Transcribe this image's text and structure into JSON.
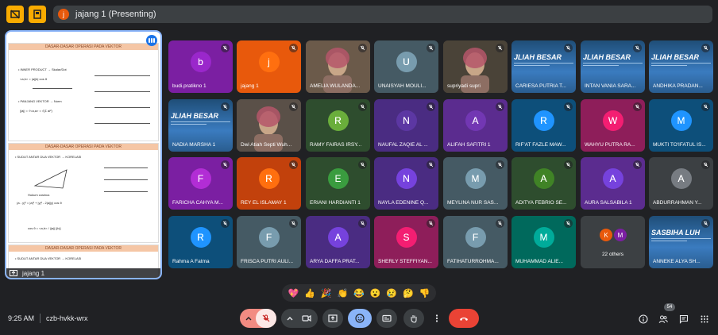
{
  "colors": {
    "accent": "#8ab4f8",
    "leave": "#ea4335",
    "active_btn": "#8ab4f8",
    "warning": "#f9ab00"
  },
  "topbar": {
    "presenter_initial": "j",
    "presenting_text": "jajang 1 (Presenting)"
  },
  "stage": {
    "presenter_label": "jajang 1",
    "slides": [
      {
        "heading": "DASAR-DASAR OPERASI PADA VEKTOR",
        "lines": [
          "• INNER PRODUCT → Skalar/Dot",
          "<a,b> = |a||b| cos θ",
          "• PANJANG VEKTOR → Norm",
          "||a|| = √<a,a> = √(Σ ai²)"
        ]
      },
      {
        "heading": "DASAR-DASAR OPERASI PADA VEKTOR",
        "lines": [
          "• SUDUT ANTAR DUA VEKTOR → KORELASI",
          "Hukum cosinus",
          "(a - y)² = |a|² + |y|² - 2|a||y| cos θ",
          "cos θ = <a,b> / ||a|| ||b||"
        ]
      },
      {
        "heading": "DASAR-DASAR OPERASI PADA VEKTOR",
        "lines": [
          "• SUDUT ANTAR DUA VEKTOR → KORELASI"
        ]
      }
    ]
  },
  "tiles": [
    {
      "name": "budi.pratikno 1",
      "initial": "b",
      "bg": "#7b1fa2",
      "av": "#7b1fa2",
      "type": "initial"
    },
    {
      "name": "jajang 1",
      "initial": "j",
      "bg": "#e8590c",
      "av": "#e8590c",
      "type": "initial"
    },
    {
      "name": "AMELIA WULANDA...",
      "type": "camera",
      "bg": "#6b5a4a"
    },
    {
      "name": "UNAISYAH MOULI...",
      "initial": "U",
      "bg": "#455a64",
      "av": "#607d8b",
      "type": "initial"
    },
    {
      "name": "supriyadi supri",
      "type": "camera",
      "bg": "#4a4338"
    },
    {
      "name": "CARIESA PUTRIA T...",
      "type": "banner",
      "banner": "JLIAH BESAR"
    },
    {
      "name": "INTAN VANIA SARA...",
      "type": "banner",
      "banner": "JLIAH BESAR"
    },
    {
      "name": "ANDHIKA PRADAN...",
      "type": "banner",
      "banner": "JLIAH BESAR"
    },
    {
      "name": "NADIA MARSHA 1",
      "type": "banner",
      "banner": "JLIAH BESAR"
    },
    {
      "name": "Dwi Atiah Septi Wuh...",
      "type": "camera",
      "bg": "#5a5048"
    },
    {
      "name": "RAMY FAIRAS IRSY...",
      "initial": "R",
      "bg": "#2e4d2e",
      "av": "#558b2f",
      "type": "initial"
    },
    {
      "name": "NAUFAL ZAQIE AL ...",
      "initial": "N",
      "bg": "#4a2c82",
      "av": "#4a2c82",
      "type": "initial"
    },
    {
      "name": "ALIFAH SAFITRI 1",
      "initial": "A",
      "bg": "#5b2c8f",
      "av": "#5b2c8f",
      "type": "initial"
    },
    {
      "name": "RIF'AT FAZLE MAW...",
      "initial": "R",
      "bg": "#0d4f7a",
      "av": "#1976d2",
      "type": "initial"
    },
    {
      "name": "WAHYU PUTRA RA...",
      "initial": "W",
      "bg": "#8e1e5a",
      "av": "#c2185b",
      "type": "initial"
    },
    {
      "name": "MUKTI TO'IFATUL IS...",
      "initial": "M",
      "bg": "#0d4f7a",
      "av": "#1976d2",
      "type": "initial"
    },
    {
      "name": "FARICHA CAHYA M...",
      "initial": "F",
      "bg": "#7b1fa2",
      "av": "#8e24aa",
      "type": "initial"
    },
    {
      "name": "REY EL ISLAMAY 1",
      "initial": "R",
      "bg": "#c2410c",
      "av": "#e8590c",
      "type": "initial"
    },
    {
      "name": "ERIANI HARDIANTI 1",
      "initial": "E",
      "bg": "#2e4d2e",
      "av": "#2e7d32",
      "type": "initial"
    },
    {
      "name": "NAYLA EDENINE Q...",
      "initial": "N",
      "bg": "#4a2c82",
      "av": "#5e35b1",
      "type": "initial"
    },
    {
      "name": "MEYLINA NUR SAS...",
      "initial": "M",
      "bg": "#455a64",
      "av": "#607d8b",
      "type": "initial"
    },
    {
      "name": "ADITYA FEBRIO SE...",
      "initial": "A",
      "bg": "#2e4d2e",
      "av": "#33691e",
      "type": "initial"
    },
    {
      "name": "AURA SALSABILA 1",
      "initial": "A",
      "bg": "#5b2c8f",
      "av": "#5e35b1",
      "type": "initial"
    },
    {
      "name": "ABDURRAHMAN Y...",
      "initial": "A",
      "bg": "#3c4043",
      "av": "#5f6368",
      "type": "initial"
    },
    {
      "name": "Rahma A Fatma",
      "initial": "R",
      "bg": "#0d4f7a",
      "av": "#1976d2",
      "type": "initial"
    },
    {
      "name": "FRISCA PUTRI AULI...",
      "initial": "F",
      "bg": "#455a64",
      "av": "#607d8b",
      "type": "initial"
    },
    {
      "name": "ARYA DAFFA PRAT...",
      "initial": "A",
      "bg": "#4a2c82",
      "av": "#5e35b1",
      "type": "initial"
    },
    {
      "name": "SHERLY STEFFIYAN...",
      "initial": "S",
      "bg": "#8e1e5a",
      "av": "#c2185b",
      "type": "initial"
    },
    {
      "name": "FATIHATURROHMA...",
      "initial": "F",
      "bg": "#455a64",
      "av": "#607d8b",
      "type": "initial"
    },
    {
      "name": "MUHAMMAD ALIE...",
      "initial": "M",
      "bg": "#00695c",
      "av": "#00897b",
      "type": "initial"
    },
    {
      "name": "22 others",
      "type": "others",
      "initials": [
        "K",
        "M"
      ]
    },
    {
      "name": "ANNEKE ALYA SH...",
      "type": "banner2",
      "banner": "SASBIHA LUH"
    }
  ],
  "reactions": [
    "💖",
    "👍",
    "🎉",
    "👏",
    "😂",
    "😮",
    "😢",
    "🤔",
    "👎"
  ],
  "bottombar": {
    "time": "9:25 AM",
    "meeting_code": "czb-hvkk-wrx",
    "people_count": "54"
  }
}
